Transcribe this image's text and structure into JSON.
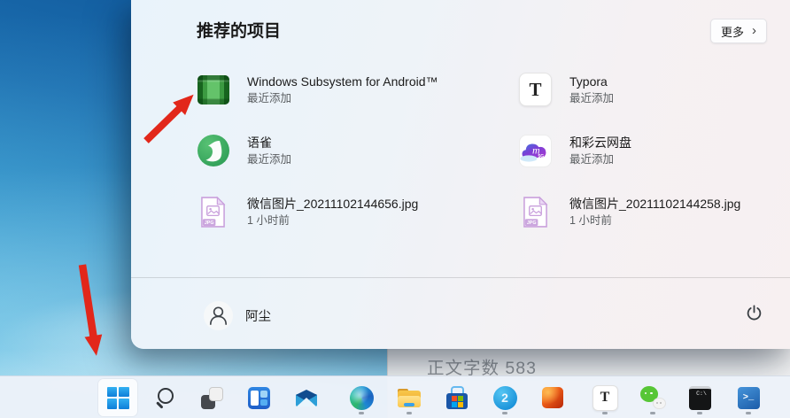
{
  "start_menu": {
    "section_title": "推荐的项目",
    "more_button": {
      "label": "更多"
    },
    "items": [
      {
        "title": "Windows Subsystem for Android™",
        "subtitle": "最近添加",
        "icon": "wsa-cube-icon"
      },
      {
        "title": "Typora",
        "subtitle": "最近添加",
        "icon": "typora-icon"
      },
      {
        "title": "语雀",
        "subtitle": "最近添加",
        "icon": "yuque-bird-icon"
      },
      {
        "title": "和彩云网盘",
        "subtitle": "最近添加",
        "icon": "hecaiyun-cloud-icon"
      },
      {
        "title": "微信图片_20211102144656.jpg",
        "subtitle": "1 小时前",
        "icon": "jpg-file-icon"
      },
      {
        "title": "微信图片_20211102144258.jpg",
        "subtitle": "1 小时前",
        "icon": "jpg-file-icon"
      }
    ],
    "user": {
      "name": "阿尘"
    }
  },
  "background_window": {
    "status_text": "正文字数 583"
  },
  "icons": {
    "more_chevron": "›",
    "typora_letter": "T",
    "jpg_label": "JPG",
    "hecaiyun_letter": "m",
    "hecaiyun_badge": "5G",
    "blue_app_glyph": "2",
    "cmd_text": "C:\\",
    "powershell_glyph": ">_"
  },
  "taskbar": {
    "buttons": [
      {
        "name": "start",
        "active": true,
        "running": false
      },
      {
        "name": "search",
        "running": false
      },
      {
        "name": "task-view",
        "running": false
      },
      {
        "name": "widgets",
        "running": false
      },
      {
        "name": "mail",
        "running": false
      },
      {
        "name": "edge",
        "running": true
      },
      {
        "name": "file-explorer",
        "running": true
      },
      {
        "name": "microsoft-store",
        "running": false
      },
      {
        "name": "blue-circle-app",
        "running": true
      },
      {
        "name": "office",
        "running": false
      },
      {
        "name": "typora",
        "running": true
      },
      {
        "name": "wechat",
        "running": true
      },
      {
        "name": "command-prompt",
        "running": true
      },
      {
        "name": "powershell",
        "running": true
      }
    ]
  },
  "annotations": {
    "arrows": [
      {
        "color": "#e2271a",
        "points_to": "windows-subsystem-for-android-item"
      },
      {
        "color": "#e2271a",
        "points_to": "start-button"
      }
    ]
  },
  "colors": {
    "arrow_red": "#e2271a",
    "taskbar_bg": "#ecf2f9",
    "menu_bg_left": "#e9f3fb",
    "menu_bg_right": "#f7f0f1",
    "windows_blue": "#0e7ed8"
  }
}
